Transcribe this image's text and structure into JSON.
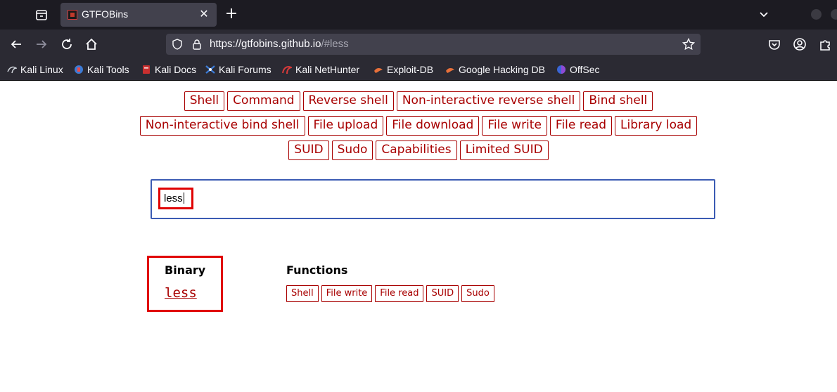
{
  "browser": {
    "tab_title": "GTFOBins",
    "url_host": "https://gtfobins.github.io",
    "url_path": "/#less",
    "bookmarks": [
      "Kali Linux",
      "Kali Tools",
      "Kali Docs",
      "Kali Forums",
      "Kali NetHunter",
      "Exploit-DB",
      "Google Hacking DB",
      "OffSec"
    ]
  },
  "categories": {
    "row1": [
      "Shell",
      "Command",
      "Reverse shell",
      "Non-interactive reverse shell",
      "Bind shell"
    ],
    "row2": [
      "Non-interactive bind shell",
      "File upload",
      "File download",
      "File write",
      "File read",
      "Library load"
    ],
    "row3": [
      "SUID",
      "Sudo",
      "Capabilities",
      "Limited SUID"
    ]
  },
  "search": {
    "value": "less"
  },
  "results": {
    "binary_header": "Binary",
    "functions_header": "Functions",
    "binary": "less",
    "functions": [
      "Shell",
      "File write",
      "File read",
      "SUID",
      "Sudo"
    ]
  },
  "colors": {
    "accent": "#a80000",
    "highlight": "#e00000",
    "focus": "#3b5bb3"
  }
}
